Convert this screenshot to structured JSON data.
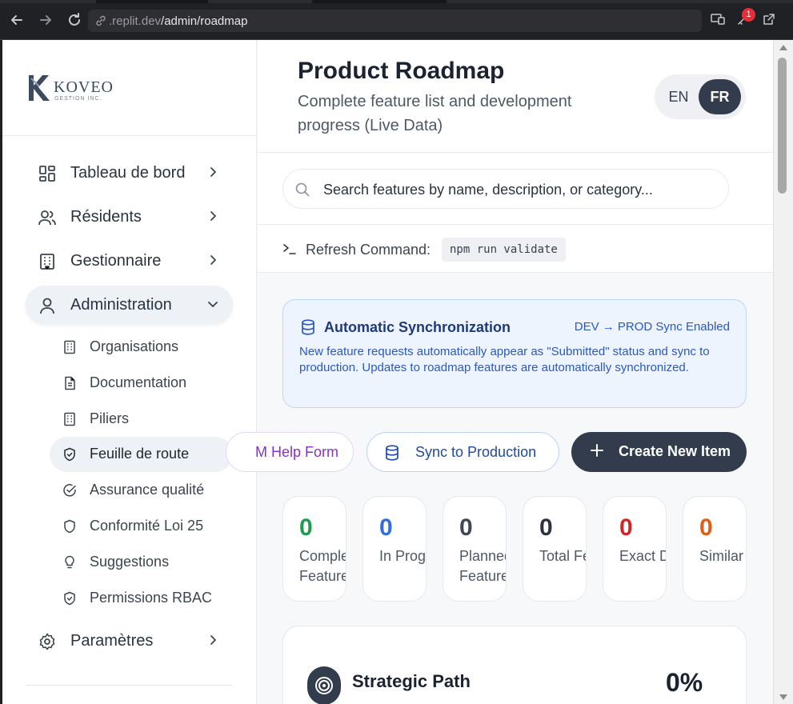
{
  "browser": {
    "url_host": ".replit.dev",
    "url_path": "/admin/roadmap",
    "notification_count": "1"
  },
  "sidebar": {
    "logo": {
      "name": "KOVEO",
      "tagline": "GESTION INC."
    },
    "nav": [
      {
        "label": "Tableau de bord",
        "icon": "dashboard-icon"
      },
      {
        "label": "Résidents",
        "icon": "users-icon"
      },
      {
        "label": "Gestionnaire",
        "icon": "building-icon"
      },
      {
        "label": "Administration",
        "icon": "user-icon",
        "expanded": true
      },
      {
        "label": "Paramètres",
        "icon": "gear-icon"
      }
    ],
    "admin_items": [
      {
        "label": "Organisations",
        "icon": "building-icon"
      },
      {
        "label": "Documentation",
        "icon": "document-icon"
      },
      {
        "label": "Piliers",
        "icon": "building-icon"
      },
      {
        "label": "Feuille de route",
        "icon": "shield-icon",
        "active": true
      },
      {
        "label": "Assurance qualité",
        "icon": "check-circle-icon"
      },
      {
        "label": "Conformité Loi 25",
        "icon": "shield-icon"
      },
      {
        "label": "Suggestions",
        "icon": "lightbulb-icon"
      },
      {
        "label": "Permissions RBAC",
        "icon": "shield-check-icon"
      }
    ]
  },
  "header": {
    "title": "Product Roadmap",
    "subtitle": "Complete feature list and development progress (Live Data)",
    "lang_en": "EN",
    "lang_fr": "FR",
    "lang_active": "FR"
  },
  "search": {
    "placeholder": "Search features by name, description, or category..."
  },
  "refresh": {
    "label": "Refresh Command:",
    "command": "npm run validate"
  },
  "sync": {
    "title": "Automatic Synchronization",
    "status": "DEV → PROD Sync Enabled",
    "description": "New feature requests automatically appear as \"Submitted\" status and sync to production. Updates to roadmap features are automatically synchronized."
  },
  "actions": {
    "help_form": "M Help Form",
    "sync_production": "Sync to Production",
    "create_new": "Create New Item"
  },
  "stats": [
    {
      "value": "0",
      "label": "Complete Features",
      "color": "#1f9d4d"
    },
    {
      "value": "0",
      "label": "In Progress",
      "color": "#2f6fe0"
    },
    {
      "value": "0",
      "label": "Planned Features",
      "color": "#3d4757"
    },
    {
      "value": "0",
      "label": "Total Features",
      "color": "#2b3340"
    },
    {
      "value": "0",
      "label": "Exact Duplicate",
      "color": "#d42525"
    },
    {
      "value": "0",
      "label": "Similar Features",
      "color": "#e35d12"
    }
  ],
  "strategic": {
    "title": "Strategic Path",
    "percent": "0%"
  }
}
